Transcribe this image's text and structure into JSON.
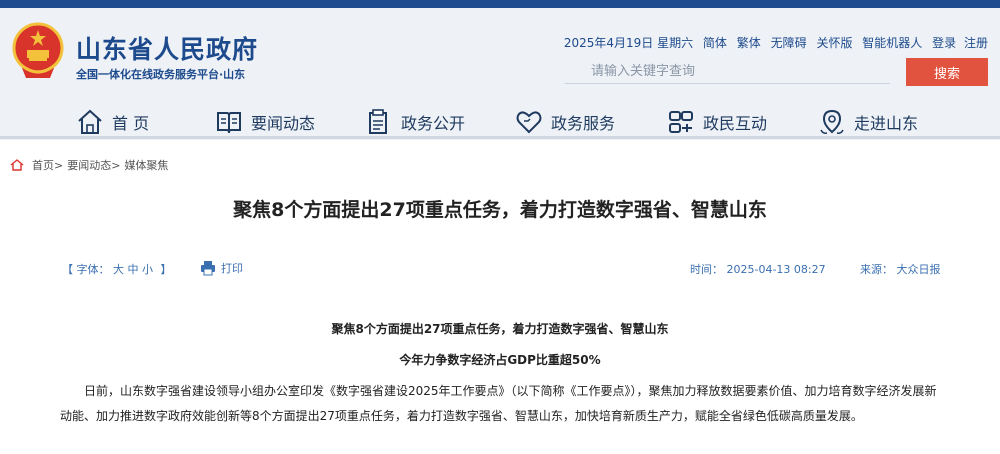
{
  "header": {
    "title": "山东省人民政府",
    "subtitle": "全国一体化在线政务服务平台·山东",
    "utility": {
      "date": "2025年4月19日 星期六",
      "links": [
        "简体",
        "繁体",
        "无障碍",
        "关怀版",
        "智能机器人",
        "登录",
        "注册"
      ]
    },
    "search": {
      "placeholder": "请输入关键字查询",
      "button": "搜索"
    },
    "nav": [
      {
        "label": "首 页",
        "icon": "home-icon"
      },
      {
        "label": "要闻动态",
        "icon": "book-icon"
      },
      {
        "label": "政务公开",
        "icon": "document-icon"
      },
      {
        "label": "政务服务",
        "icon": "heart-icon"
      },
      {
        "label": "政民互动",
        "icon": "interaction-icon"
      },
      {
        "label": "走进山东",
        "icon": "location-icon"
      }
    ]
  },
  "breadcrumb": {
    "items": [
      "首页>",
      "要闻动态>",
      "媒体聚焦"
    ]
  },
  "article": {
    "title": "聚焦8个方面提出27项重点任务，着力打造数字强省、智慧山东",
    "font_label": "【 字体：",
    "font_big": "大",
    "font_mid": "中",
    "font_small": "小",
    "font_close": "】",
    "print": "打印",
    "time": "时间：  2025-04-13 08:27",
    "source": "来源：  大众日报",
    "lead1": "聚焦8个方面提出27项重点任务，着力打造数字强省、智慧山东",
    "lead2": "今年力争数字经济占GDP比重超50%",
    "body": "日前，山东数字强省建设领导小组办公室印发《数字强省建设2025年工作要点》（以下简称《工作要点》），聚焦加力释放数据要素价值、加力培育数字经济发展新动能、加力推进数字政府效能创新等8个方面提出27项重点任务，着力打造数字强省、智慧山东，加快培育新质生产力，赋能全省绿色低碳高质量发展。"
  },
  "colors": {
    "brand_blue": "#1d4a8c",
    "search_red": "#e2533f",
    "header_bg": "#eef2f7",
    "link_blue": "#3a6fb0"
  }
}
